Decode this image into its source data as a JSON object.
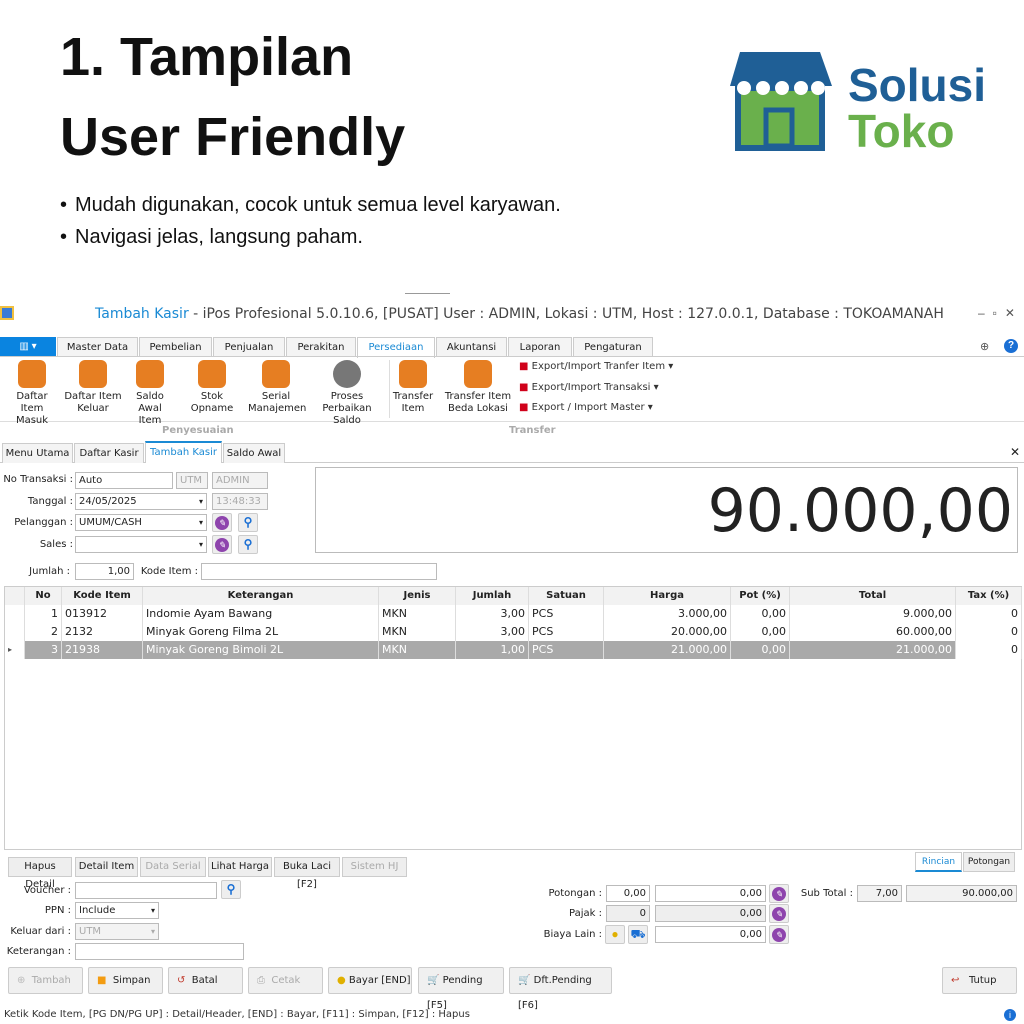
{
  "heading": {
    "line1": "1. Tampilan",
    "line2": "User Friendly"
  },
  "logo": {
    "line1": "Solusi",
    "line2": "Toko"
  },
  "bullets": [
    "Mudah digunakan, cocok untuk semua level karyawan.",
    "Navigasi jelas, langsung paham."
  ],
  "window": {
    "title_app": "Tambah Kasir",
    "title_rest": " - iPos Profesional 5.0.10.6, [PUSAT] User : ADMIN, Lokasi : UTM, Host : 127.0.0.1, Database : TOKOAMANAH"
  },
  "menu_tabs": [
    "Master Data",
    "Pembelian",
    "Penjualan",
    "Perakitan",
    "Persediaan",
    "Akuntansi",
    "Laporan",
    "Pengaturan"
  ],
  "ribbon": {
    "items": [
      "Daftar Item Masuk",
      "Daftar Item Keluar",
      "Saldo Awal Item",
      "Stok Opname",
      "Serial Manajemen",
      "Proses Perbaikan Saldo",
      "Transfer Item",
      "Transfer Item Beda Lokasi"
    ],
    "exports": [
      "Export/Import Tranfer Item",
      "Export/Import Transaksi",
      "Export / Import Master"
    ],
    "groups": [
      "Penyesuaian",
      "Transfer"
    ]
  },
  "doc_tabs": [
    "Menu Utama",
    "Daftar Kasir",
    "Tambah Kasir",
    "Saldo Awal"
  ],
  "form": {
    "no_transaksi_label": "No Transaksi :",
    "no_transaksi": "Auto",
    "lokasi": "UTM",
    "user": "ADMIN",
    "tanggal_label": "Tanggal :",
    "tanggal": "24/05/2025",
    "jam": "13:48:33",
    "pelanggan_label": "Pelanggan :",
    "pelanggan": "UMUM/CASH",
    "sales_label": "Sales :",
    "sales": "",
    "jumlah_label": "Jumlah :",
    "jumlah": "1,00",
    "kode_item_label": "Kode Item :",
    "kode_item": ""
  },
  "total_display": "90.000,00",
  "table": {
    "headers": [
      "No",
      "Kode Item",
      "Keterangan",
      "Jenis",
      "Jumlah",
      "Satuan",
      "Harga",
      "Pot (%)",
      "Total",
      "Tax (%)"
    ],
    "rows": [
      [
        "1",
        "013912",
        "Indomie Ayam Bawang",
        "MKN",
        "3,00",
        "PCS",
        "3.000,00",
        "0,00",
        "9.000,00",
        "0"
      ],
      [
        "2",
        "2132",
        "Minyak Goreng Filma 2L",
        "MKN",
        "3,00",
        "PCS",
        "20.000,00",
        "0,00",
        "60.000,00",
        "0"
      ],
      [
        "3",
        "21938",
        "Minyak Goreng Bimoli 2L",
        "MKN",
        "1,00",
        "PCS",
        "21.000,00",
        "0,00",
        "21.000,00",
        "0"
      ]
    ]
  },
  "detail_buttons": [
    "Hapus Detail",
    "Detail Item",
    "Data Serial",
    "Lihat Harga",
    "Buka Laci [F2]",
    "Sistem HJ"
  ],
  "side_tabs": [
    "Rincian",
    "Potongan"
  ],
  "bottom": {
    "voucher_label": "Voucher :",
    "voucher": "",
    "ppn_label": "PPN :",
    "ppn": "Include",
    "keluar_label": "Keluar dari :",
    "keluar": "UTM",
    "keterangan_label": "Keterangan :",
    "keterangan": "",
    "potongan_label": "Potongan :",
    "potongan_pct": "0,00",
    "potongan": "0,00",
    "pajak_label": "Pajak :",
    "pajak_pct": "0",
    "pajak": "0,00",
    "biaya_label": "Biaya Lain :",
    "biaya": "0,00",
    "subtotal_label": "Sub Total :",
    "subtotal_qty": "7,00",
    "subtotal": "90.000,00"
  },
  "actions": [
    "Tambah",
    "Simpan",
    "Batal",
    "Cetak",
    "Bayar [END]",
    "Pending [F5]",
    "Dft.Pending [F6]",
    "Tutup"
  ],
  "status": "Ketik Kode Item, [PG DN/PG UP] : Detail/Header, [END] : Bayar, [F11] : Simpan, [F12] : Hapus",
  "colors": {
    "accent": "#0a84e0",
    "logo_blue": "#1f5f96",
    "logo_green": "#6ab04c",
    "selected_row": "#a9a9a9"
  }
}
